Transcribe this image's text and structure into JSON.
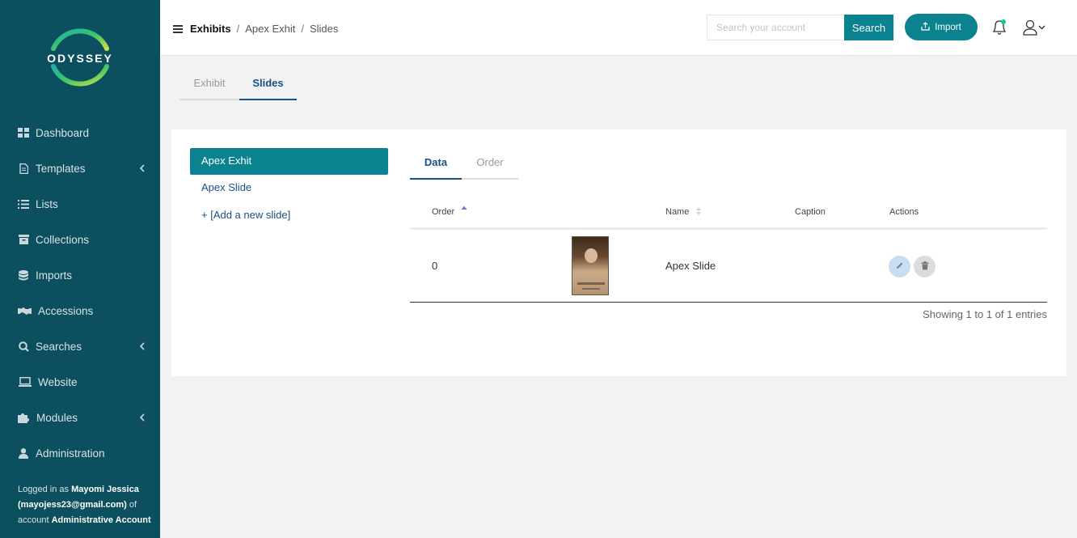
{
  "sidebar": {
    "logo_text": "ODYSSEY",
    "items": [
      {
        "label": "Dashboard",
        "icon": "dashboard-icon",
        "has_chevron": false
      },
      {
        "label": "Templates",
        "icon": "file-icon",
        "has_chevron": true
      },
      {
        "label": "Lists",
        "icon": "list-icon",
        "has_chevron": false
      },
      {
        "label": "Collections",
        "icon": "archive-icon",
        "has_chevron": false
      },
      {
        "label": "Imports",
        "icon": "database-icon",
        "has_chevron": false
      },
      {
        "label": "Accessions",
        "icon": "handshake-icon",
        "has_chevron": false
      },
      {
        "label": "Searches",
        "icon": "search-icon",
        "has_chevron": true
      },
      {
        "label": "Website",
        "icon": "laptop-icon",
        "has_chevron": false
      },
      {
        "label": "Modules",
        "icon": "puzzle-icon",
        "has_chevron": true
      },
      {
        "label": "Administration",
        "icon": "user-icon",
        "has_chevron": false
      }
    ],
    "login": {
      "prefix": "Logged in as",
      "name": "Mayomi Jessica",
      "email": "(mayojess23@gmail.com)",
      "of_account": "of account",
      "account": "Administrative Account"
    }
  },
  "header": {
    "breadcrumb": [
      "Exhibits",
      "Apex Exhit",
      "Slides"
    ],
    "search_placeholder": "Search your account",
    "search_label": "Search",
    "import_label": "Import"
  },
  "page_tabs": [
    "Exhibit",
    "Slides"
  ],
  "slides": {
    "items": [
      "Apex Exhit",
      "Apex Slide"
    ],
    "add_label": "+ [Add a new slide]"
  },
  "inner_tabs": [
    "Data",
    "Order"
  ],
  "table": {
    "columns": [
      "Order",
      "Name",
      "Caption",
      "Actions"
    ],
    "rows": [
      {
        "order": "0",
        "name": "Apex Slide",
        "caption": ""
      }
    ],
    "footer": "Showing 1 to 1 of 1 entries"
  },
  "colors": {
    "sidebar": "#0c4f5e",
    "accent": "#0b8290",
    "link": "#1a4f86"
  }
}
